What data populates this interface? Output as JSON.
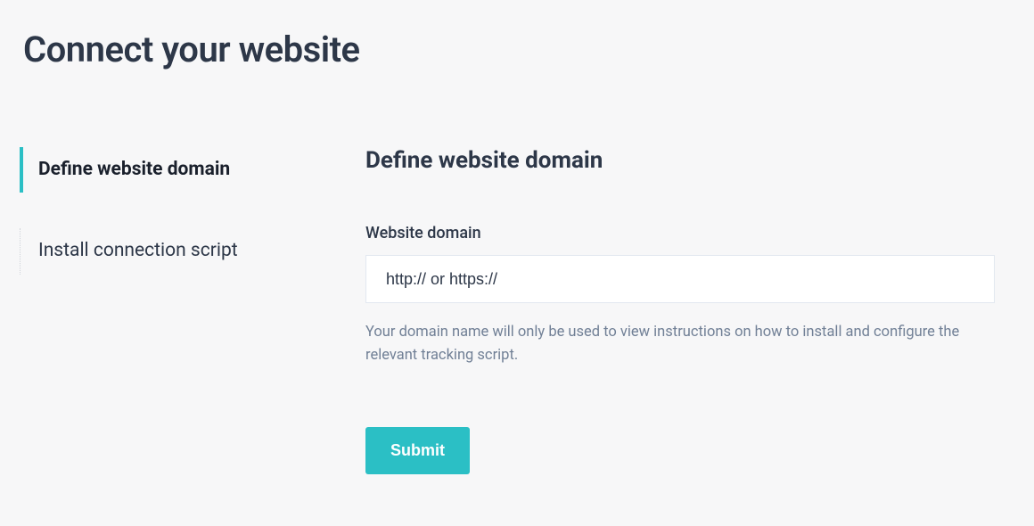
{
  "page": {
    "title": "Connect your website"
  },
  "sidebar": {
    "items": [
      {
        "label": "Define website domain",
        "active": true
      },
      {
        "label": "Install connection script",
        "active": false
      }
    ]
  },
  "main": {
    "heading": "Define website domain",
    "field": {
      "label": "Website domain",
      "placeholder": "http:// or https://",
      "value": ""
    },
    "helper_text": "Your domain name will only be used to view instructions on how to install and configure the relevant tracking script.",
    "submit_label": "Submit"
  },
  "colors": {
    "accent": "#2bbfc5",
    "text_primary": "#2d3748",
    "text_muted": "#718096",
    "background": "#f7f7f8"
  }
}
